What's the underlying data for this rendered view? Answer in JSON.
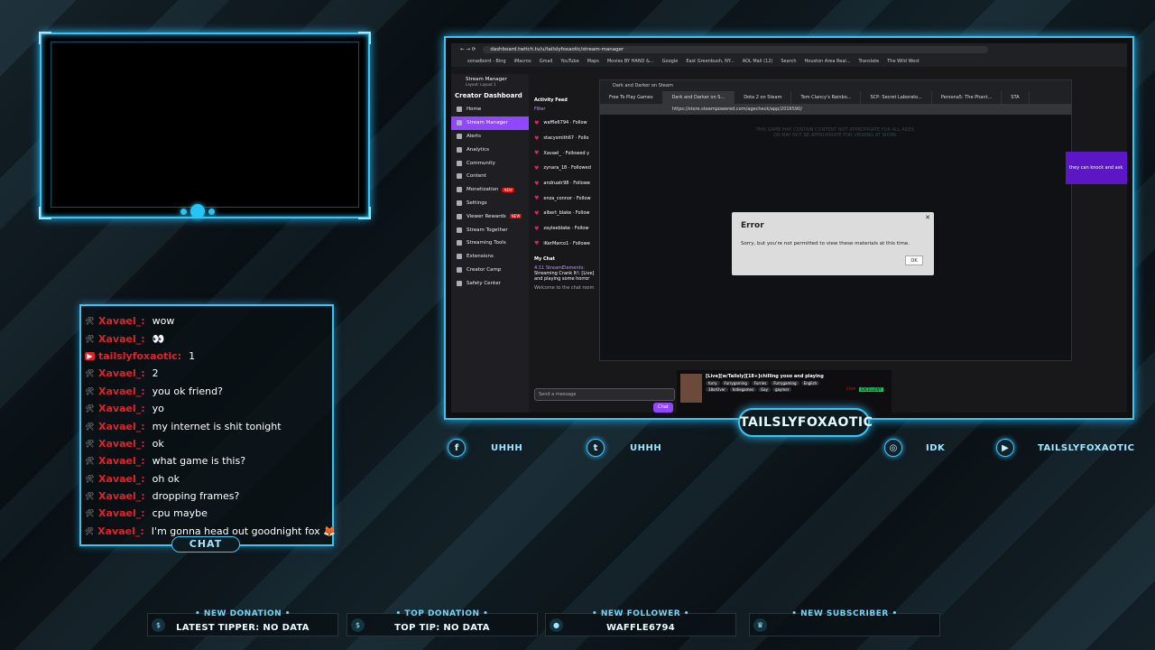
{
  "colors": {
    "accent": "#3ec3f0",
    "twitch_purple": "#9147ff",
    "username_red": "#e0232a"
  },
  "chat": {
    "label": "CHAT",
    "messages": [
      {
        "user": "Xavael_:",
        "text": "wow",
        "badge": "mod-icon"
      },
      {
        "user": "Xavael_:",
        "text": "👀",
        "badge": "mod-icon"
      },
      {
        "user": "tailslyfoxaotic:",
        "text": "1",
        "badge": "broadcaster-icon"
      },
      {
        "user": "Xavael_:",
        "text": "2",
        "badge": "mod-icon"
      },
      {
        "user": "Xavael_:",
        "text": "you ok friend?",
        "badge": "mod-icon"
      },
      {
        "user": "Xavael_:",
        "text": "yo",
        "badge": "mod-icon"
      },
      {
        "user": "Xavael_:",
        "text": "my internet is shit tonight",
        "badge": "mod-icon"
      },
      {
        "user": "Xavael_:",
        "text": "ok",
        "badge": "mod-icon"
      },
      {
        "user": "Xavael_:",
        "text": "what game is this?",
        "badge": "mod-icon"
      },
      {
        "user": "Xavael_:",
        "text": "oh ok",
        "badge": "mod-icon"
      },
      {
        "user": "Xavael_:",
        "text": "dropping frames?",
        "badge": "mod-icon"
      },
      {
        "user": "Xavael_:",
        "text": "cpu maybe",
        "badge": "mod-icon"
      },
      {
        "user": "Xavael_:",
        "text": "I'm gonna head out goodnight fox 🦊",
        "badge": "mod-icon"
      }
    ]
  },
  "browser": {
    "url": "dashboard.twitch.tv/u/tailslyfoxaotic/stream-manager",
    "bookmarks": [
      "sonadbord - Bing",
      "iMacros",
      "Gmail",
      "YouTube",
      "Maps",
      "Movies BY HAND &...",
      "Google",
      "East Greenbush, NY...",
      "AOL Mail (12)",
      "Search",
      "Houston Area Real...",
      "Translate",
      "The Wild West"
    ],
    "sidebar": {
      "header": "Stream Manager",
      "layout": "Layout: Layout 1",
      "title": "Creator Dashboard",
      "new_badge": "NEW",
      "items": [
        "Home",
        "Stream Manager",
        "Alerts",
        "Analytics",
        "Community",
        "Content",
        "Monetization",
        "Settings",
        "Viewer Rewards",
        "Stream Together",
        "Streaming Tools",
        "Extensions",
        "Creator Camp",
        "Safety Center"
      ]
    },
    "feed": {
      "title": "Activity Feed",
      "filter": "Filter",
      "rows": [
        "waffle6794 · Follow",
        "stacysmith67 · Follo",
        "Xavael_ · Followed y",
        "zynara_18 · Followed",
        "andruatr98 · Followe",
        "enza_connor · Follow",
        "albert_blake · Follow",
        "zayleeblake · Follow",
        "iKerMarco1 · Followe"
      ]
    },
    "my_chat": {
      "title": "My Chat",
      "line1": "4:11 StreamElements:",
      "line2": "Streaming Crank It!: [Live]",
      "line3": "and playing some horror",
      "line4": "Welcome to the chat room",
      "placeholder": "Send a message",
      "button": "Chat"
    },
    "steam": {
      "window_title": "Dark and Darker on Steam",
      "tabs": [
        "Free To Play Games",
        "Dark and Darker on S...",
        "Dota 2 on Steam",
        "Tom Clancy's Rainbo...",
        "SCP: Secret Laborato...",
        "Persona5: The Phant...",
        "STA"
      ],
      "url": "https://store.steampowered.com/agecheck/app/2016590/",
      "warning1": "THIS GAME MAY CONTAIN CONTENT NOT APPROPRIATE FOR ALL AGES,",
      "warning2": "OR MAY NOT BE APPROPRIATE FOR VIEWING AT WORK.",
      "error_title": "Error",
      "error_msg": "Sorry, but you're not permitted to view these materials at this time.",
      "error_ok": "OK"
    },
    "stream_card": {
      "title": "[Live][w/Tailsly][18+]chilling yooo and playing",
      "tags": [
        "furry",
        "Furrygaming",
        "Furries",
        "Furrygaming",
        "English",
        "18orOver",
        "Indiegames",
        "Gay",
        "gaymer"
      ],
      "live": "Live",
      "health": "EXCELLENT"
    },
    "purple_text": "they can knock and ask"
  },
  "name_plate": "TAILSLYFOXAOTIC",
  "socials": [
    {
      "icon": "facebook-icon",
      "glyph": "f",
      "text": "UHHH"
    },
    {
      "icon": "twitter-icon",
      "glyph": "t",
      "text": "UHHH"
    },
    {
      "icon": "instagram-icon",
      "glyph": "◎",
      "text": "IDK"
    },
    {
      "icon": "youtube-icon",
      "glyph": "▶",
      "text": "TAILSLYFOXAOTIC"
    }
  ],
  "alerts": [
    {
      "icon": "dollar-icon",
      "glyph": "$",
      "label": "• NEW DONATION •",
      "value": "LATEST TIPPER: NO DATA"
    },
    {
      "icon": "money-bag-icon",
      "glyph": "$",
      "label": "• TOP DONATION •",
      "value": "TOP TIP: NO DATA"
    },
    {
      "icon": "user-icon",
      "glyph": "●",
      "label": "• NEW FOLLOWER •",
      "value": "WAFFLE6794"
    },
    {
      "icon": "crown-icon",
      "glyph": "♛",
      "label": "• NEW SUBSCRIBER •",
      "value": ""
    }
  ]
}
